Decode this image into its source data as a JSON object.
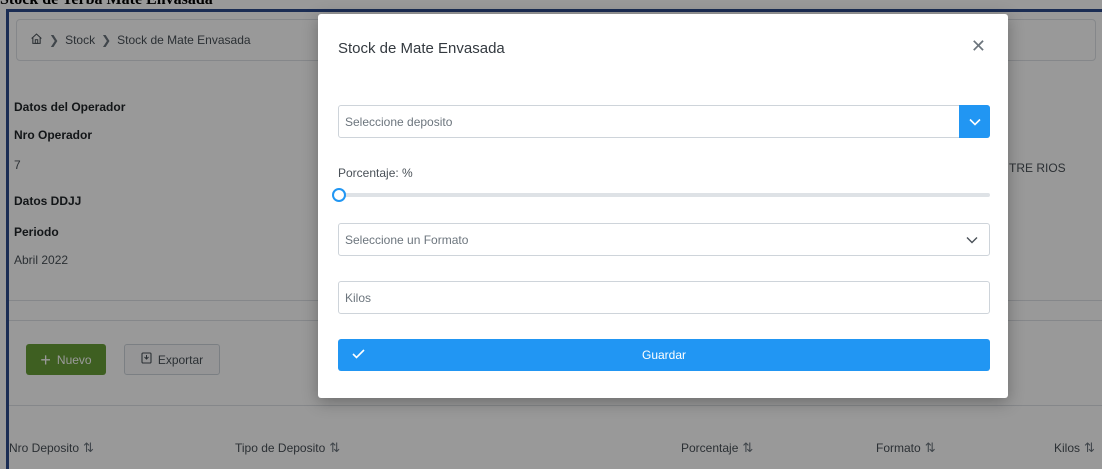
{
  "page": {
    "title": "Stock de Yerba Mate Envasada"
  },
  "breadcrumb": {
    "items": [
      "Stock",
      "Stock de Mate Envasada"
    ]
  },
  "operator": {
    "section_label": "Datos del Operador",
    "nro_label": "Nro Operador",
    "nro_value": "7",
    "ddjj_label": "Datos DDJJ",
    "periodo_label": "Periodo",
    "periodo_value": "Abril 2022",
    "province_partial": "TRE RIOS"
  },
  "toolbar": {
    "new_label": "Nuevo",
    "export_label": "Exportar"
  },
  "table": {
    "columns": [
      "Nro Deposito",
      "Tipo de Deposito",
      "Porcentaje",
      "Formato",
      "Kilos"
    ]
  },
  "modal": {
    "title": "Stock de Mate Envasada",
    "deposito_placeholder": "Seleccione deposito",
    "porcentaje_label": "Porcentaje: %",
    "porcentaje_value": 0,
    "formato_placeholder": "Seleccione un Formato",
    "kilos_placeholder": "Kilos",
    "save_label": "Guardar"
  },
  "colors": {
    "primary": "#2196f3",
    "success": "#689f38",
    "frame": "#2c4a8a"
  }
}
